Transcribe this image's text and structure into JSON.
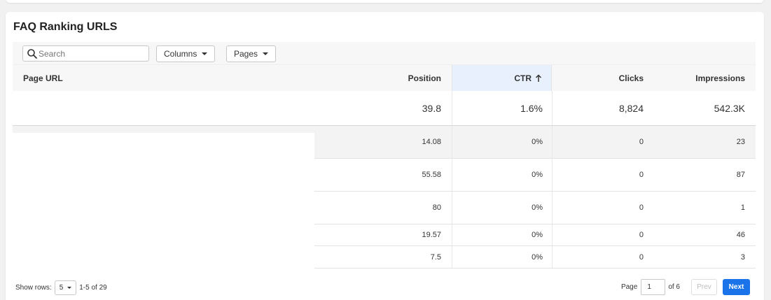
{
  "card": {
    "title": "FAQ Ranking URLS"
  },
  "toolbar": {
    "search_placeholder": "Search",
    "columns_label": "Columns",
    "pages_label": "Pages"
  },
  "table": {
    "columns": [
      "Page URL",
      "Position",
      "CTR",
      "Clicks",
      "Impressions"
    ],
    "sorted_column": "CTR",
    "sort_direction": "ascending",
    "summary": {
      "position": "39.8",
      "ctr": "1.6%",
      "clicks": "8,824",
      "impressions": "542.3K"
    },
    "rows": [
      {
        "position": "14.08",
        "ctr": "0%",
        "clicks": "0",
        "impressions": "23"
      },
      {
        "position": "55.58",
        "ctr": "0%",
        "clicks": "0",
        "impressions": "87"
      },
      {
        "position": "80",
        "ctr": "0%",
        "clicks": "0",
        "impressions": "1"
      },
      {
        "position": "19.57",
        "ctr": "0%",
        "clicks": "0",
        "impressions": "46"
      },
      {
        "position": "7.5",
        "ctr": "0%",
        "clicks": "0",
        "impressions": "3"
      }
    ]
  },
  "footer": {
    "show_rows_label": "Show rows:",
    "rows_per_page": "5",
    "range": "1-5 of 29",
    "page_label": "Page",
    "current_page": "1",
    "of_pages": "of 6",
    "prev_label": "Prev",
    "next_label": "Next"
  },
  "colors": {
    "accent": "#1a73e8",
    "sorted_header_bg": "#e8f0fe",
    "row_highlight": "#f3f3f3"
  },
  "icons": {
    "search": "search-icon",
    "sort": "arrow-up-icon",
    "dropdown": "caret-down-icon"
  }
}
